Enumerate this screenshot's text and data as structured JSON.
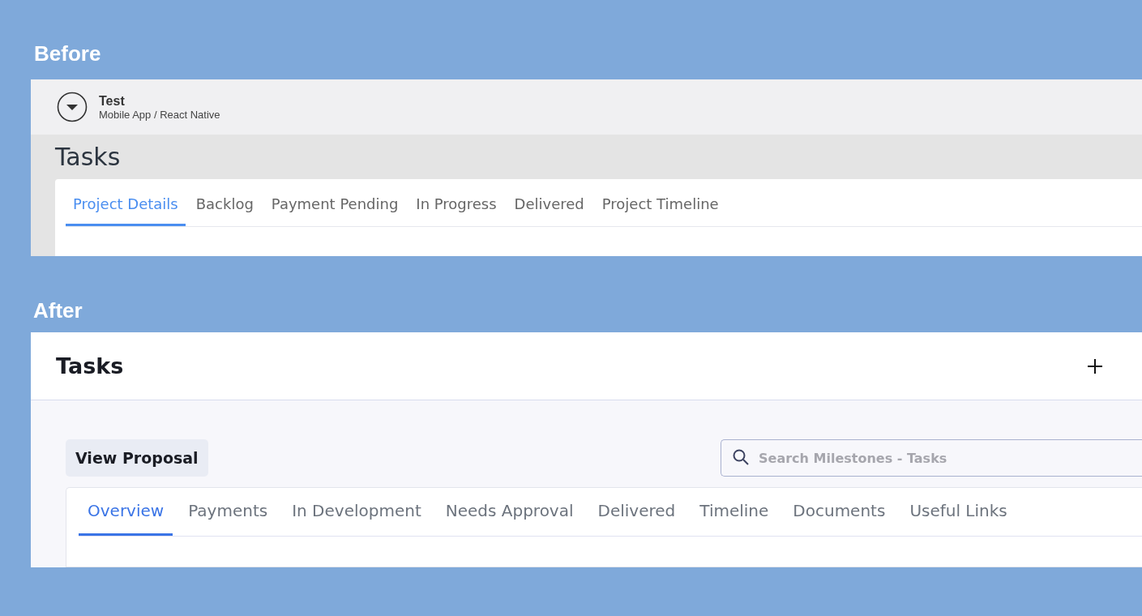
{
  "before": {
    "label": "Before",
    "project": {
      "name": "Test",
      "path": "Mobile App / React Native"
    },
    "title": "Tasks",
    "tabs": [
      {
        "label": "Project Details",
        "selected": true
      },
      {
        "label": "Backlog",
        "selected": false
      },
      {
        "label": "Payment Pending",
        "selected": false
      },
      {
        "label": "In Progress",
        "selected": false
      },
      {
        "label": "Delivered",
        "selected": false
      },
      {
        "label": "Project Timeline",
        "selected": false
      }
    ]
  },
  "after": {
    "label": "After",
    "title": "Tasks",
    "button": "View Proposal",
    "search": {
      "placeholder": "Search Milestones - Tasks"
    },
    "tabs": [
      {
        "label": "Overview",
        "selected": true
      },
      {
        "label": "Payments",
        "selected": false
      },
      {
        "label": "In Development",
        "selected": false
      },
      {
        "label": "Needs Approval",
        "selected": false
      },
      {
        "label": "Delivered",
        "selected": false
      },
      {
        "label": "Timeline",
        "selected": false
      },
      {
        "label": "Documents",
        "selected": false
      },
      {
        "label": "Useful Links",
        "selected": false
      }
    ]
  }
}
